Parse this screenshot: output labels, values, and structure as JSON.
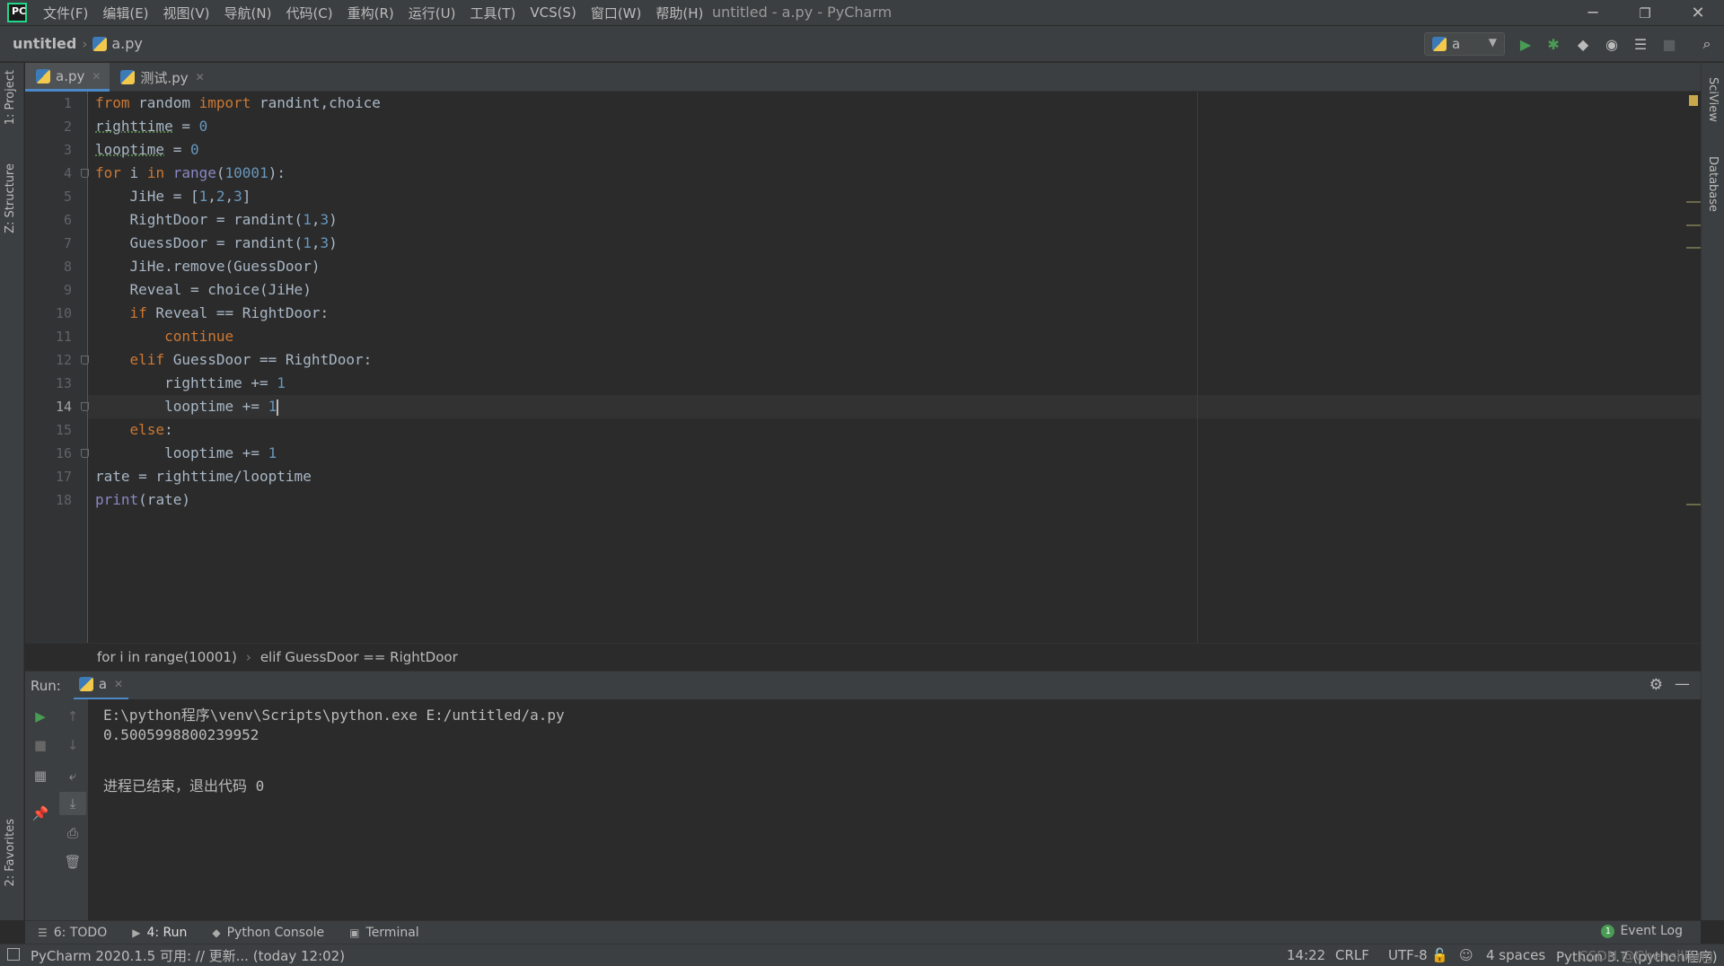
{
  "window": {
    "title": "untitled - a.py - PyCharm",
    "minimize": "─",
    "restore": "❐",
    "close": "✕"
  },
  "menu": [
    "文件(F)",
    "编辑(E)",
    "视图(V)",
    "导航(N)",
    "代码(C)",
    "重构(R)",
    "运行(U)",
    "工具(T)",
    "VCS(S)",
    "窗口(W)",
    "帮助(H)"
  ],
  "navbar": {
    "project": "untitled",
    "file": "a.py",
    "run_config": "a"
  },
  "left_tools": {
    "project": "1: Project",
    "structure": "Z: Structure",
    "favorites": "2: Favorites"
  },
  "right_tools": {
    "sciview": "SciView",
    "database": "Database"
  },
  "editor_tabs": [
    {
      "label": "a.py",
      "active": true
    },
    {
      "label": "测试.py",
      "active": false
    }
  ],
  "editor": {
    "current_line": 14,
    "lines": [
      "from random import randint,choice",
      "righttime = 0",
      "looptime = 0",
      "for i in range(10001):",
      "    JiHe = [1,2,3]",
      "    RightDoor = randint(1,3)",
      "    GuessDoor = randint(1,3)",
      "    JiHe.remove(GuessDoor)",
      "    Reveal = choice(JiHe)",
      "    if Reveal == RightDoor:",
      "        continue",
      "    elif GuessDoor == RightDoor:",
      "        righttime += 1",
      "        looptime += 1",
      "    else:",
      "        looptime += 1",
      "rate = righttime/looptime",
      "print(rate)"
    ],
    "breadcrumb": [
      "for i in range(10001)",
      "elif GuessDoor == RightDoor"
    ]
  },
  "run": {
    "label": "Run:",
    "tab": "a",
    "console": [
      "E:\\python程序\\venv\\Scripts\\python.exe E:/untitled/a.py",
      "0.5005998800239952",
      "",
      "进程已结束，退出代码 0"
    ]
  },
  "bottom_tabs": [
    {
      "label": "6: TODO",
      "icon": "todo-icon"
    },
    {
      "label": "4: Run",
      "icon": "run-icon"
    },
    {
      "label": "Python Console",
      "icon": "python-console-icon"
    },
    {
      "label": "Terminal",
      "icon": "terminal-icon"
    }
  ],
  "event_log": {
    "label": "Event Log",
    "count": "1"
  },
  "status": {
    "message": "PyCharm 2020.1.5 可用: // 更新... (today 12:02)",
    "position": "14:22",
    "line_sep": "CRLF",
    "encoding": "UTF-8",
    "indent": "4 spaces",
    "interpreter": "Python 3.7 (python程序)",
    "watermark": "CSDN @Chensiliang"
  }
}
